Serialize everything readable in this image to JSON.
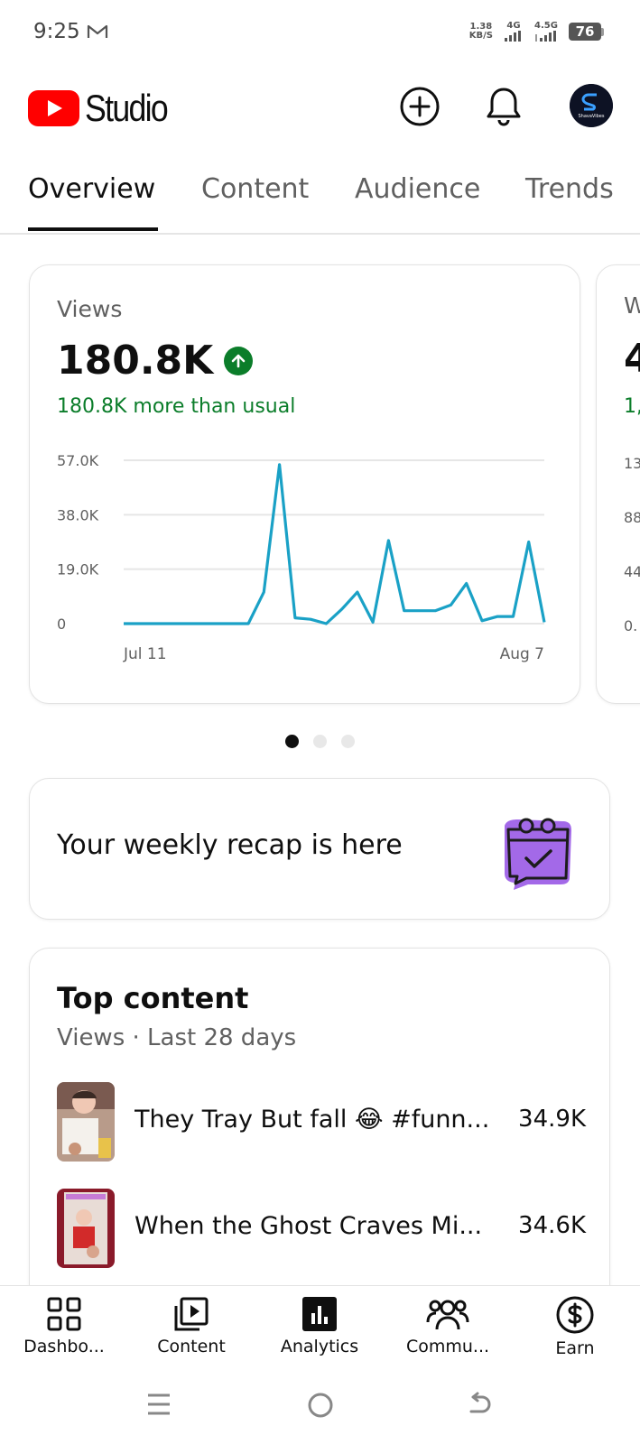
{
  "status_bar": {
    "time": "9:25",
    "net_speed_value": "1.38",
    "net_speed_unit": "KB/S",
    "signal1_label": "4G",
    "signal2_label": "4.5G",
    "battery": "76"
  },
  "header": {
    "app_name": "Studio",
    "avatar_text": "ShavaVibes"
  },
  "tabs": [
    {
      "label": "Overview",
      "active": true
    },
    {
      "label": "Content",
      "active": false
    },
    {
      "label": "Audience",
      "active": false
    },
    {
      "label": "Trends",
      "active": false
    }
  ],
  "views_card": {
    "label": "Views",
    "value": "180.8K",
    "comparison": "180.8K more than usual"
  },
  "peek_card": {
    "label": "W",
    "value": "4",
    "comparison": "1,",
    "ticks": [
      "13",
      "88",
      "44",
      "0."
    ]
  },
  "chart_data": {
    "type": "line",
    "x_start_label": "Jul 11",
    "x_end_label": "Aug 7",
    "y_tick_labels": [
      "57.0K",
      "38.0K",
      "19.0K",
      "0"
    ],
    "ylim": [
      0,
      57000
    ],
    "color": "#1aa1c6",
    "values": [
      0,
      0,
      0,
      0,
      0,
      0,
      0,
      0,
      0,
      11000,
      55500,
      2000,
      1500,
      0,
      5000,
      11000,
      500,
      29000,
      4500,
      4500,
      4500,
      6500,
      14000,
      1000,
      2500,
      2500,
      28500,
      500
    ]
  },
  "pager": {
    "count": 3,
    "active": 0
  },
  "recap": {
    "text": "Your weekly recap is here"
  },
  "top_content": {
    "title": "Top content",
    "subtitle": "Views · Last 28 days",
    "items": [
      {
        "title": "They Tray But fall 😂 #funn...",
        "views": "34.9K"
      },
      {
        "title": "When the Ghost Craves Mi...",
        "views": "34.6K"
      }
    ]
  },
  "bottom_nav": [
    {
      "label": "Dashbo...",
      "icon": "dashboard-icon"
    },
    {
      "label": "Content",
      "icon": "content-icon"
    },
    {
      "label": "Analytics",
      "icon": "analytics-icon"
    },
    {
      "label": "Commu...",
      "icon": "community-icon"
    },
    {
      "label": "Earn",
      "icon": "earn-icon"
    }
  ],
  "colors": {
    "brand_red": "#ff0000",
    "positive_green": "#0b7d2a",
    "chart_line": "#1aa1c6"
  }
}
